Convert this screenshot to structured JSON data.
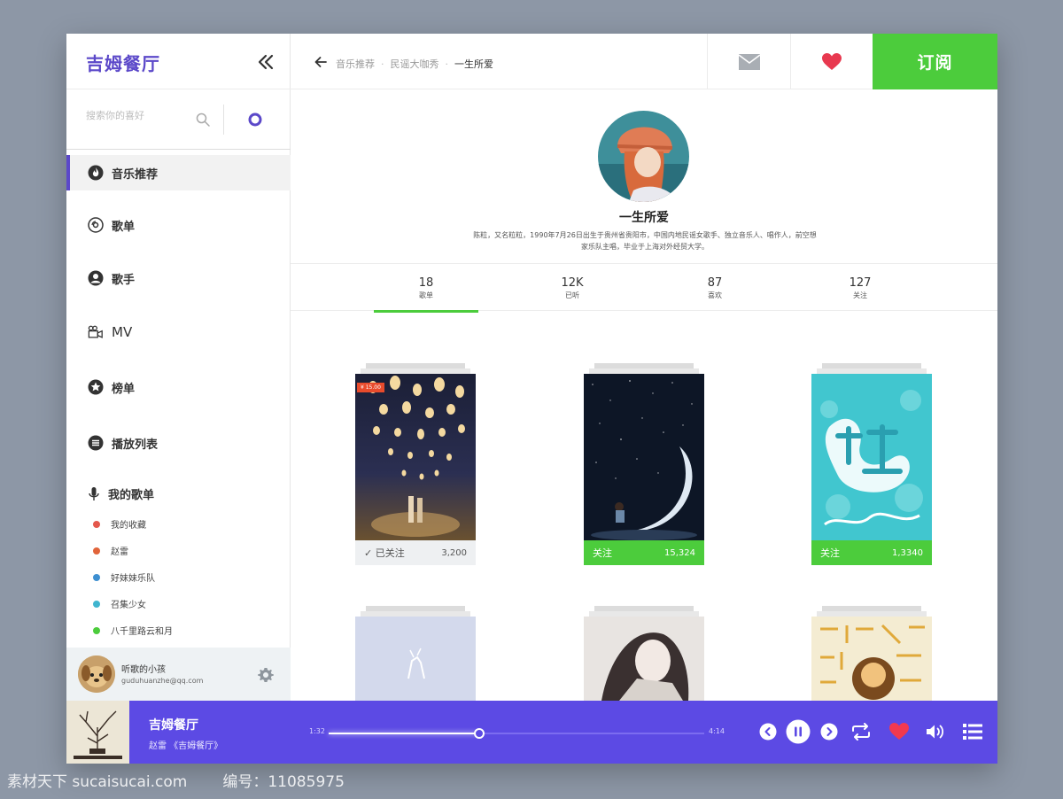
{
  "sidebar": {
    "logo": "吉姆餐厅",
    "search_placeholder": "搜索你的喜好",
    "nav": [
      {
        "label": "音乐推荐",
        "icon": "flame-icon"
      },
      {
        "label": "歌单",
        "icon": "disc-icon"
      },
      {
        "label": "歌手",
        "icon": "person-icon"
      },
      {
        "label": "MV",
        "icon": "video-camera-icon"
      },
      {
        "label": "榜单",
        "icon": "star-icon"
      },
      {
        "label": "播放列表",
        "icon": "list-icon"
      }
    ],
    "my_playlists": {
      "title": "我的歌单",
      "items": [
        {
          "label": "我的收藏",
          "color": "#e4584c"
        },
        {
          "label": "赵雷",
          "color": "#e1643a"
        },
        {
          "label": "好妹妹乐队",
          "color": "#3d8fd1"
        },
        {
          "label": "召集少女",
          "color": "#3fb5cf"
        },
        {
          "label": "八千里路云和月",
          "color": "#4ccc3c"
        }
      ]
    },
    "user": {
      "name": "听歌的小孩",
      "email": "guduhuanzhe@qq.com"
    }
  },
  "topbar": {
    "breadcrumb": [
      "音乐推荐",
      "民谣大咖秀",
      "一生所爱"
    ],
    "subscribe_label": "订阅"
  },
  "profile": {
    "name": "一生所爱",
    "bio_line1": "陈粒，又名粒粒，1990年7月26日出生于贵州省贵阳市，中国内地民谣女歌手、独立音乐人、唱作人，前空想",
    "bio_line2": "家乐队主唱，毕业于上海对外经贸大学。"
  },
  "stats": [
    {
      "value": "18",
      "caption": "歌单"
    },
    {
      "value": "12K",
      "caption": "已听"
    },
    {
      "value": "87",
      "caption": "喜欢"
    },
    {
      "value": "127",
      "caption": "关注"
    }
  ],
  "albums": [
    {
      "price": "¥ 15.00",
      "follow_label": "已关注",
      "count": "3,200",
      "followed": true
    },
    {
      "follow_label": "关注",
      "count": "15,324",
      "followed": false
    },
    {
      "follow_label": "关注",
      "count": "1,3340",
      "followed": false
    }
  ],
  "player": {
    "title": "吉姆餐厅",
    "artist": "赵雷 《吉姆餐厅》",
    "time_current": "1:32",
    "time_total": "4:14",
    "progress": 0.4
  },
  "colors": {
    "brand": "#5b48c9",
    "player_bg": "#5c4ae4",
    "accent_green": "#4ccc3c",
    "heart_red": "#e8384f"
  },
  "watermark": {
    "site": "素材天下 sucaisucai.com",
    "id": "编号：11085975"
  }
}
